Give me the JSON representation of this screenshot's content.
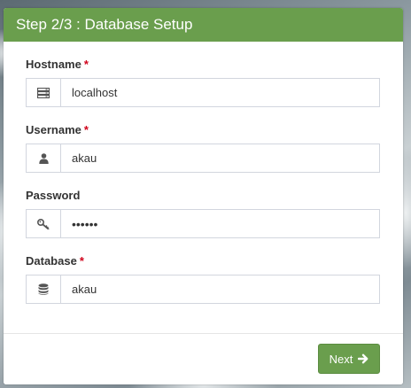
{
  "header": {
    "title": "Step 2/3 : Database Setup"
  },
  "form": {
    "hostname": {
      "label": "Hostname",
      "required_mark": "*",
      "value": "localhost",
      "icon": "server-icon"
    },
    "username": {
      "label": "Username",
      "required_mark": "*",
      "value": "akau",
      "icon": "user-icon"
    },
    "password": {
      "label": "Password",
      "value": "••••••",
      "icon": "key-icon"
    },
    "database": {
      "label": "Database",
      "required_mark": "*",
      "value": "akau",
      "icon": "database-icon"
    }
  },
  "footer": {
    "next_label": "Next",
    "next_icon": "arrow-right-icon"
  },
  "colors": {
    "accent": "#6a9e4d",
    "required": "#d0021b"
  }
}
